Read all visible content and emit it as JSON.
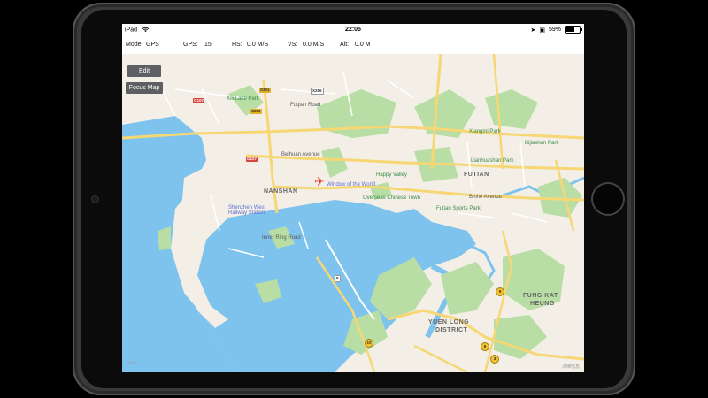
{
  "status": {
    "device": "iPad",
    "time": "22:05",
    "battery": "59%"
  },
  "info": {
    "mode_label": "Mode:",
    "mode_value": "GPS",
    "gps_label": "GPS:",
    "gps_value": "15",
    "hs_label": "HS:",
    "hs_value": "0.0 M/S",
    "vs_label": "VS:",
    "vs_value": "0.0 M/S",
    "alt_label": "Alt:",
    "alt_value": "0.0 M"
  },
  "buttons": {
    "edit": "Edit",
    "focus_map": "Focus Map"
  },
  "map": {
    "districts": {
      "nanshan": "NANSHAN",
      "futian": "FUTIAN",
      "yuen_long": "YUEN LONG",
      "district": "DISTRICT",
      "fung_kat": "FUNG KAT",
      "heung": "HEUNG"
    },
    "roads": {
      "beihuan": "Beihuan Avenue",
      "binhe": "Binhe Avenue",
      "inner_ring": "Inner Ring Road",
      "fuqian": "Fuqian Road"
    },
    "pois": {
      "window": "Window of the World",
      "happy_valley": "Happy Valley",
      "overseas": "Overseas Chinese Town",
      "futian_sports": "Futian Sports Park",
      "lianhuashan": "Lianhuashan Park",
      "bijiashan": "Bijiashan Park",
      "xiangmi": "Xiangmi Park",
      "station": "Shenzhen West Railway Station",
      "xili": "Xili Lake Park"
    },
    "shields": {
      "s107a": "G107",
      "s107b": "G107",
      "s256": "X256",
      "s301": "S301",
      "s220": "S220",
      "h9": "9",
      "h10": "10",
      "h6": "6",
      "h3": "3",
      "hk9": "9"
    },
    "legal": "法律信息",
    "scale": "2 km"
  }
}
